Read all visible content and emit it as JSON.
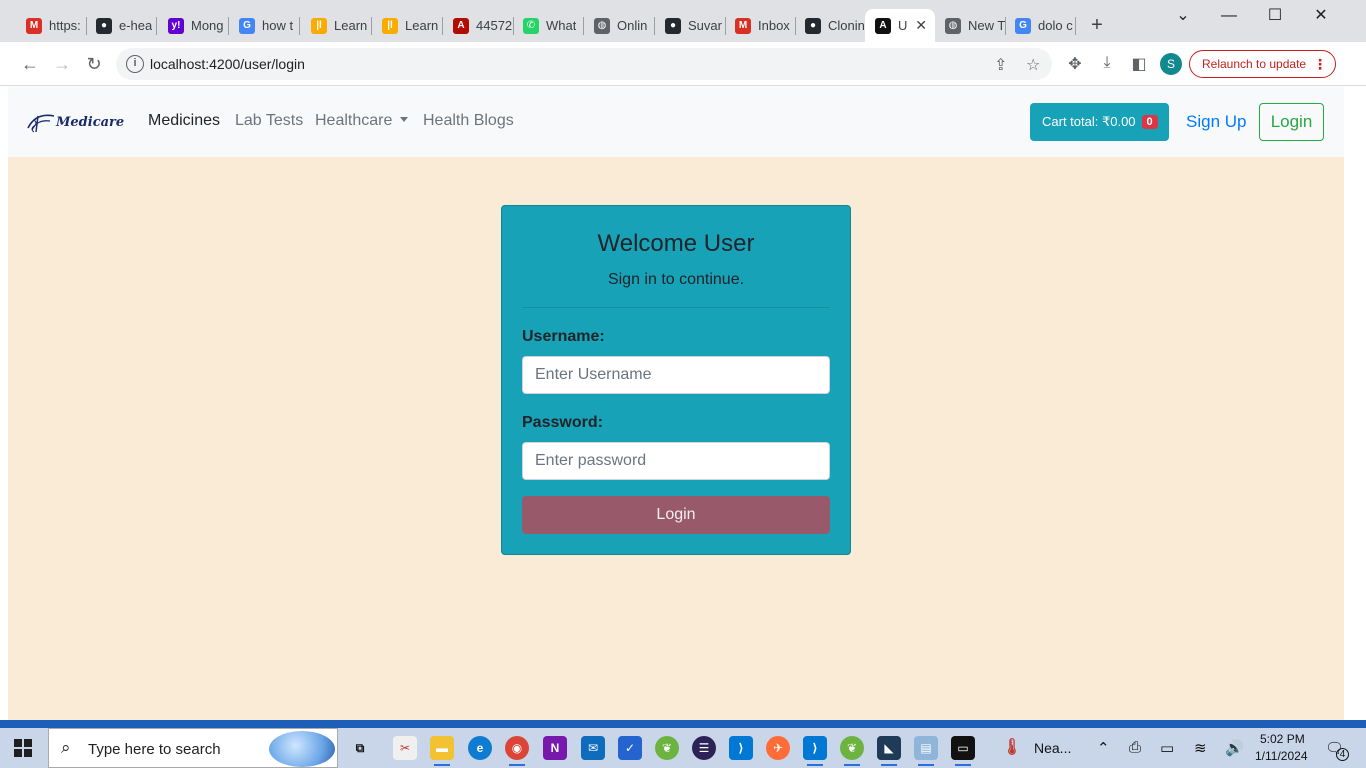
{
  "browser": {
    "tabs": [
      {
        "title": "https:",
        "icon": "gmail-icon",
        "color": "#d93025",
        "glyph": "M"
      },
      {
        "title": "e-hea",
        "icon": "github-icon",
        "color": "#24292f",
        "glyph": "●"
      },
      {
        "title": "Mong",
        "icon": "yahoo-icon",
        "color": "#6001d2",
        "glyph": "y!"
      },
      {
        "title": "how t",
        "icon": "google-icon",
        "color": "#4285f4",
        "glyph": "G"
      },
      {
        "title": "Learn",
        "icon": "analytics-icon",
        "color": "#f9ab00",
        "glyph": "|l"
      },
      {
        "title": "Learn",
        "icon": "analytics-icon",
        "color": "#f9ab00",
        "glyph": "|l"
      },
      {
        "title": "44572",
        "icon": "pdf-icon",
        "color": "#b30b00",
        "glyph": "A"
      },
      {
        "title": "What",
        "icon": "whatsapp-icon",
        "color": "#25d366",
        "glyph": "✆"
      },
      {
        "title": "Onlin",
        "icon": "globe-icon",
        "color": "#5f6368",
        "glyph": "◍"
      },
      {
        "title": "Suvar",
        "icon": "github-icon",
        "color": "#24292f",
        "glyph": "●"
      },
      {
        "title": "Inbox",
        "icon": "gmail-icon",
        "color": "#d93025",
        "glyph": "M"
      },
      {
        "title": "Clonin",
        "icon": "github-icon",
        "color": "#24292f",
        "glyph": "●"
      },
      {
        "title": "U",
        "icon": "angular-icon",
        "color": "#111111",
        "glyph": "A",
        "active": true
      },
      {
        "title": "New T",
        "icon": "globe-icon",
        "color": "#5f6368",
        "glyph": "◍"
      },
      {
        "title": "dolo c",
        "icon": "google-icon",
        "color": "#4285f4",
        "glyph": "G"
      }
    ],
    "url": "localhost:4200/user/login",
    "relaunch_label": "Relaunch to update",
    "profile_initial": "S"
  },
  "navbar": {
    "brand": "Medicare",
    "links": [
      "Medicines",
      "Lab Tests",
      "Healthcare",
      "Health Blogs"
    ],
    "cart_label": "Cart total: ₹0.00",
    "cart_count": "0",
    "signup_label": "Sign Up",
    "login_label": "Login"
  },
  "login_card": {
    "title": "Welcome User",
    "subtitle": "Sign in to continue.",
    "username_label": "Username:",
    "username_placeholder": "Enter Username",
    "password_label": "Password:",
    "password_placeholder": "Enter password",
    "submit_label": "Login"
  },
  "taskbar": {
    "search_placeholder": "Type here to search",
    "weather_label": "Nea...",
    "time": "5:02 PM",
    "date": "1/11/2024",
    "notification_count": "4"
  },
  "colors": {
    "page_bg": "#faebd7",
    "card_bg": "#17a2b8",
    "submit_bg": "#985a6b",
    "cart_bg": "#17a2b8",
    "badge_bg": "#dc3545"
  }
}
